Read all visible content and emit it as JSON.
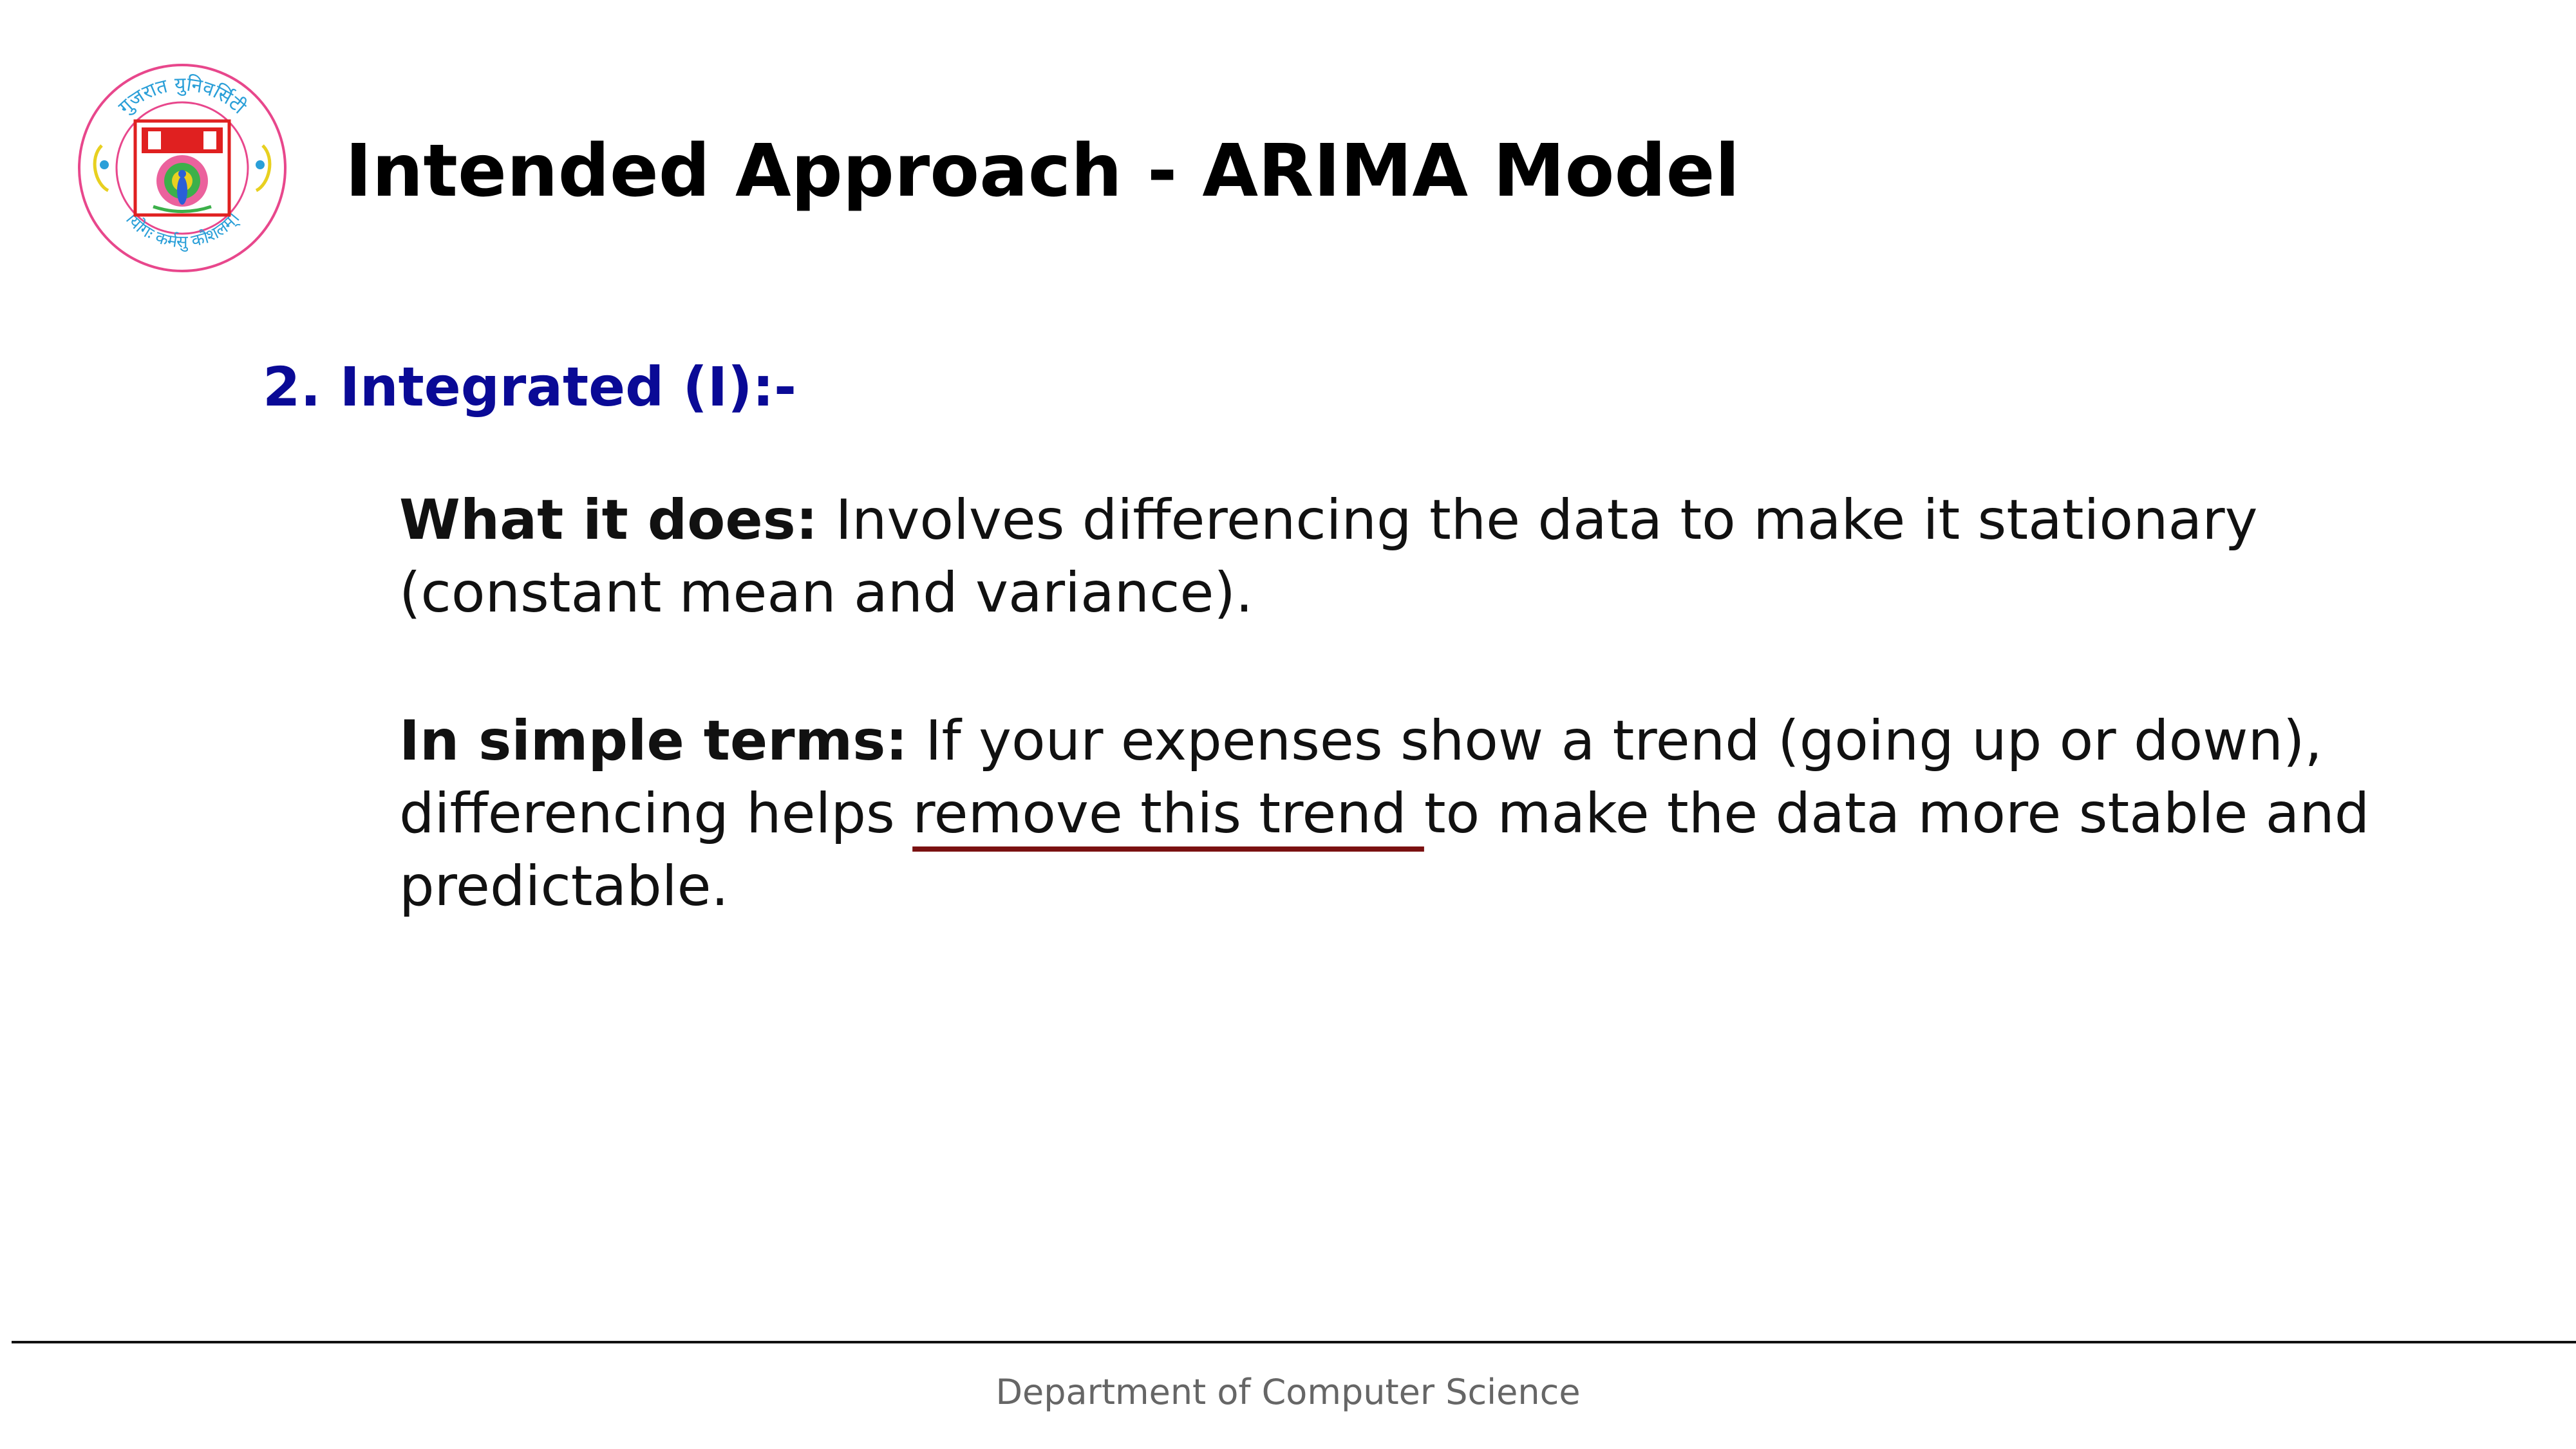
{
  "logo": {
    "top_text": "गुजरात युनिवर्सिटी",
    "bottom_text": "।योगः कर्मसु कौशलम्।",
    "ring_color": "#e8478c",
    "inner_color": "#e02020",
    "accent_color": "#e8d020",
    "text_color": "#2a9fd8"
  },
  "slide": {
    "title": "Intended Approach - ARIMA Model",
    "section_heading": "2. Integrated (I):-",
    "paragraph_1": {
      "label": "What it does:",
      "text": " Involves differencing the data to make it stationary (constant mean and variance)."
    },
    "paragraph_2": {
      "label": "In simple terms:",
      "text_before": " If your expenses show a trend (going up or down), differencing helps ",
      "underlined": "remove this trend ",
      "text_after": "to make the data more stable and predictable."
    }
  },
  "footer": {
    "text": "Department of Computer Science"
  },
  "colors": {
    "heading_blue": "#0a0a96",
    "underline": "#7a1010",
    "footer_text": "#666666"
  }
}
